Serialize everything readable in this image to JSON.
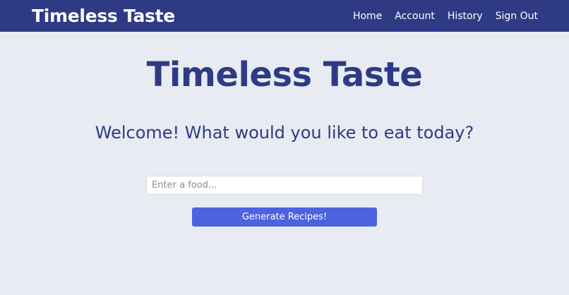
{
  "navbar": {
    "brand": "Timeless Taste",
    "links": [
      {
        "label": "Home"
      },
      {
        "label": "Account"
      },
      {
        "label": "History"
      },
      {
        "label": "Sign Out"
      }
    ]
  },
  "main": {
    "title": "Timeless Taste",
    "welcome": "Welcome! What would you like to eat today?",
    "food_input": {
      "value": "",
      "placeholder": "Enter a food..."
    },
    "generate_button_label": "Generate Recipes!"
  },
  "colors": {
    "navbar_bg": "#2e3b84",
    "page_bg": "#e8ebf2",
    "heading": "#2e3b84",
    "button_bg": "#4c63e0"
  }
}
